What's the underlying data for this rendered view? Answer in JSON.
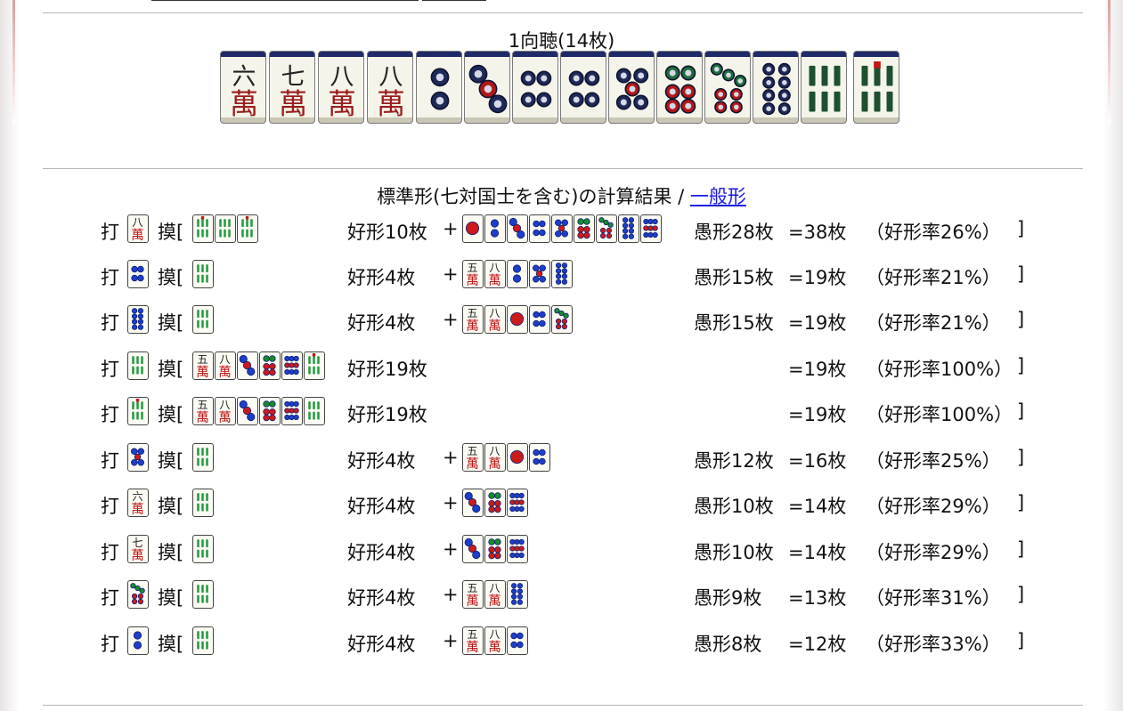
{
  "hand": {
    "title": "1向聴(14枚)",
    "tiles": [
      {
        "icon": "man-6-tile",
        "kind": "m",
        "n": 6
      },
      {
        "icon": "man-7-tile",
        "kind": "m",
        "n": 7
      },
      {
        "icon": "man-8-tile",
        "kind": "m",
        "n": 8
      },
      {
        "icon": "man-8-tile",
        "kind": "m",
        "n": 8
      },
      {
        "icon": "pin-2-tile",
        "kind": "p",
        "n": 2
      },
      {
        "icon": "pin-3-tile",
        "kind": "p",
        "n": 3
      },
      {
        "icon": "pin-4-tile",
        "kind": "p",
        "n": 4
      },
      {
        "icon": "pin-4-tile",
        "kind": "p",
        "n": 4
      },
      {
        "icon": "pin-5-tile",
        "kind": "p",
        "n": 5
      },
      {
        "icon": "pin-6-tile",
        "kind": "p",
        "n": 6
      },
      {
        "icon": "pin-7-tile",
        "kind": "p",
        "n": 7
      },
      {
        "icon": "pin-8-tile",
        "kind": "p",
        "n": 8
      },
      {
        "icon": "sou-6-tile",
        "kind": "s",
        "n": 6
      },
      {
        "icon": "sou-7-tile",
        "kind": "s",
        "n": 7
      }
    ]
  },
  "calc": {
    "title": "標準形(七対国士を含む)の計算結果 /",
    "link": "一般形"
  },
  "labels": {
    "da": "打",
    "mo": "摸[",
    "close": "]"
  },
  "rows": [
    {
      "discard": "man-8",
      "draws": [
        "sou-8",
        "sou-6",
        "sou-7"
      ],
      "good": "好形10枚",
      "plus": "+",
      "good_tiles": [
        "pin-1",
        "pin-2",
        "pin-3",
        "pin-4",
        "pin-5",
        "pin-6",
        "pin-7",
        "pin-8",
        "pin-9"
      ],
      "bad": "愚形28枚",
      "total": "=38枚",
      "rate": "（好形率26%）"
    },
    {
      "discard": "pin-4",
      "draws": [
        "sou-6"
      ],
      "good": "好形4枚",
      "plus": "+",
      "good_tiles": [
        "man-5",
        "man-8",
        "pin-2",
        "pin-5",
        "pin-8"
      ],
      "bad": "愚形15枚",
      "total": "=19枚",
      "rate": "（好形率21%）"
    },
    {
      "discard": "pin-8",
      "draws": [
        "sou-6"
      ],
      "good": "好形4枚",
      "plus": "+",
      "good_tiles": [
        "man-5",
        "man-8",
        "pin-1",
        "pin-4",
        "pin-7"
      ],
      "bad": "愚形15枚",
      "total": "=19枚",
      "rate": "（好形率21%）"
    },
    {
      "discard": "sou-6",
      "draws": [
        "man-5",
        "man-8",
        "pin-3",
        "pin-6",
        "pin-9",
        "sou-7"
      ],
      "good": "好形19枚",
      "plus": "",
      "good_tiles": [],
      "bad": "",
      "total": "=19枚",
      "rate": "（好形率100%）"
    },
    {
      "discard": "sou-7",
      "draws": [
        "man-5",
        "man-8",
        "pin-3",
        "pin-6",
        "pin-9",
        "sou-6"
      ],
      "good": "好形19枚",
      "plus": "",
      "good_tiles": [],
      "bad": "",
      "total": "=19枚",
      "rate": "（好形率100%）"
    },
    {
      "discard": "pin-5",
      "draws": [
        "sou-6"
      ],
      "good": "好形4枚",
      "plus": "+",
      "good_tiles": [
        "man-5",
        "man-8",
        "pin-1",
        "pin-4"
      ],
      "bad": "愚形12枚",
      "total": "=16枚",
      "rate": "（好形率25%）"
    },
    {
      "discard": "man-6",
      "draws": [
        "sou-6"
      ],
      "good": "好形4枚",
      "plus": "+",
      "good_tiles": [
        "pin-3",
        "pin-6",
        "pin-9"
      ],
      "bad": "愚形10枚",
      "total": "=14枚",
      "rate": "（好形率29%）"
    },
    {
      "discard": "man-7",
      "draws": [
        "sou-6"
      ],
      "good": "好形4枚",
      "plus": "+",
      "good_tiles": [
        "pin-3",
        "pin-6",
        "pin-9"
      ],
      "bad": "愚形10枚",
      "total": "=14枚",
      "rate": "（好形率29%）"
    },
    {
      "discard": "pin-7",
      "draws": [
        "sou-6"
      ],
      "good": "好形4枚",
      "plus": "+",
      "good_tiles": [
        "man-5",
        "man-8",
        "pin-8"
      ],
      "bad": "愚形9枚",
      "total": "=13枚",
      "rate": "（好形率31%）"
    },
    {
      "discard": "pin-2",
      "draws": [
        "sou-6"
      ],
      "good": "好形4枚",
      "plus": "+",
      "good_tiles": [
        "man-5",
        "man-8",
        "pin-4"
      ],
      "bad": "愚形8枚",
      "total": "=12枚",
      "rate": "（好形率33%）"
    }
  ]
}
